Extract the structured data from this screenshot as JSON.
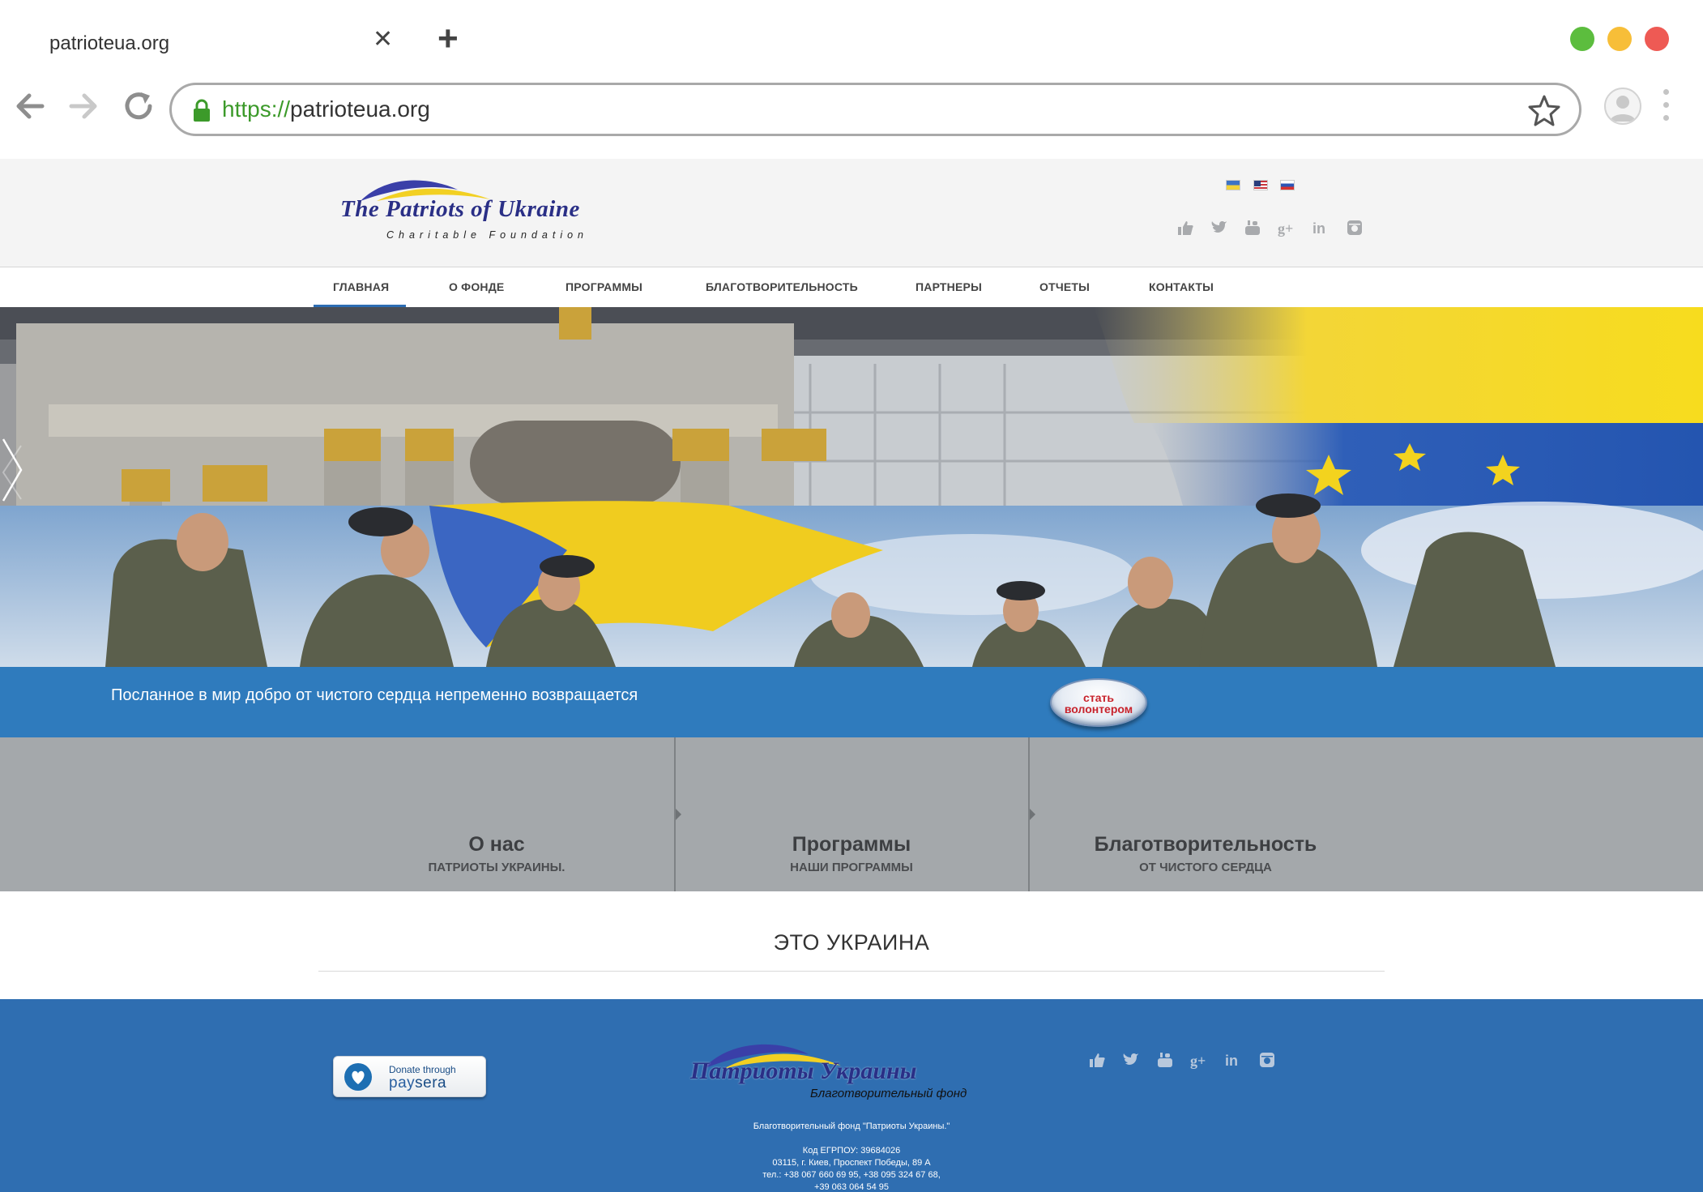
{
  "browser": {
    "tab_title": "patrioteua.org",
    "url_scheme": "https://",
    "url_host": "patrioteua.org"
  },
  "header": {
    "logo_text": "The Patriots of Ukraine",
    "logo_subtitle": "Charitable Foundation",
    "languages": [
      "ua-flag-icon",
      "us-flag-icon",
      "ru-flag-icon"
    ],
    "social_icons": [
      "like-icon",
      "twitter-icon",
      "youtube-icon",
      "google-plus-icon",
      "linkedin-icon",
      "instagram-icon"
    ]
  },
  "nav": {
    "items": [
      {
        "label": "ГЛАВНАЯ",
        "active": true
      },
      {
        "label": "О ФОНДЕ",
        "active": false
      },
      {
        "label": "ПРОГРАММЫ",
        "active": false
      },
      {
        "label": "БЛАГОТВОРИТЕЛЬНОСТЬ",
        "active": false
      },
      {
        "label": "ПАРТНЕРЫ",
        "active": false
      },
      {
        "label": "ОТЧЕТЫ",
        "active": false
      },
      {
        "label": "КОНТАКТЫ",
        "active": false
      }
    ]
  },
  "slogan_bar": {
    "text": "Посланное в мир добро от чистого сердца непременно возвращается",
    "volunteer_line1": "стать",
    "volunteer_line2": "волонтером"
  },
  "features": [
    {
      "title": "О нас",
      "subtitle": "ПАТРИОТЫ УКРАИНЫ."
    },
    {
      "title": "Программы",
      "subtitle": "НАШИ ПРОГРАММЫ"
    },
    {
      "title": "Благотворительность",
      "subtitle": "ОТ ЧИСТОГО СЕРДЦА"
    }
  ],
  "section": {
    "heading": "ЭТО УКРАИНА"
  },
  "footer": {
    "donate_line1": "Donate through",
    "donate_pay": "pay",
    "donate_sera": "sera",
    "logo_text": "Патриоты Украины",
    "logo_subtitle": "Благотворительный фонд",
    "org_name": "Благотворительный фонд \"Патриоты Украины.\"",
    "code": "Код ЕГРПОУ: 39684026",
    "address": "03115, г. Киев, Проспект Победы, 89 А",
    "phones": "тел.: +38 067 660 69 95, +38 095 324 67 68,",
    "phones2": "+39 063 064 54 95"
  },
  "colors": {
    "accent_blue": "#2f7bbd",
    "footer_blue": "#2f6eb1",
    "feature_grey": "#a4a8ab",
    "ukraine_yellow": "#f5d21a",
    "ukraine_blue": "#2b5cb8"
  }
}
